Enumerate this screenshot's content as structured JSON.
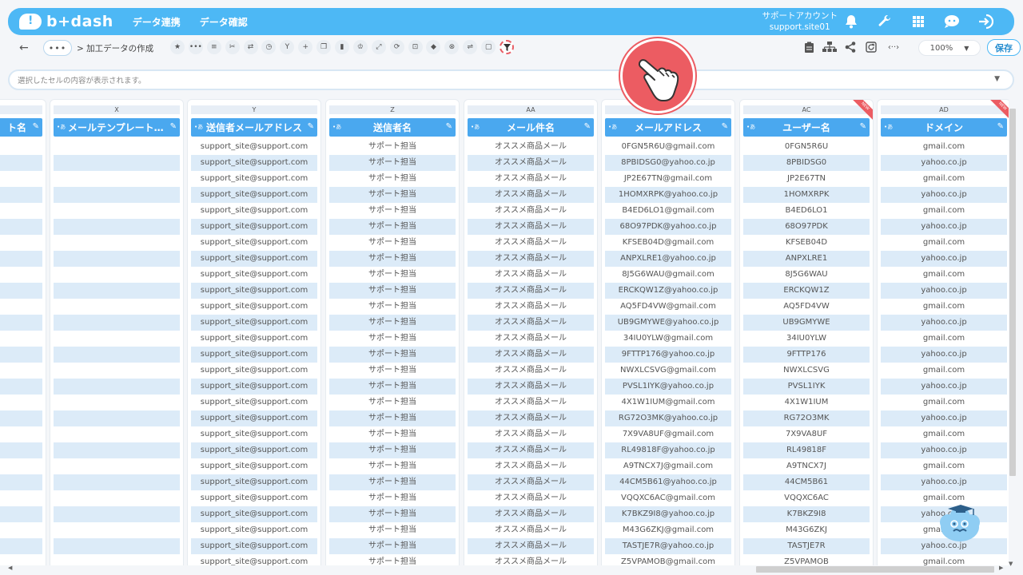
{
  "header": {
    "logo_text": "b+dash",
    "nav": [
      "データ連携",
      "データ確認"
    ],
    "account_label": "サポートアカウント",
    "account_id": "support.site01",
    "icons": [
      "bell-icon",
      "wrench-icon",
      "grid-icon",
      "chat-icon",
      "logout-icon"
    ]
  },
  "toolbar": {
    "more_label": "•••",
    "breadcrumb": "> 加工データの作成",
    "tool_icons": [
      "star-icon",
      "more-icon",
      "list-icon",
      "scissors-icon",
      "merge-icon",
      "timer-icon",
      "branch-icon",
      "plus-icon",
      "copy-icon",
      "trash-icon",
      "crown-icon",
      "expand-icon",
      "repeat-icon",
      "lock-icon",
      "box-icon",
      "close-circle-icon",
      "shuffle-icon",
      "square-icon",
      "filter-icon"
    ],
    "active_tool": "filter-icon",
    "right_icons": [
      "clipboard-icon",
      "hierarchy-icon",
      "share-icon",
      "refresh-icon",
      "code-icon"
    ],
    "zoom": "100%",
    "save_label": "保存"
  },
  "cellbar": {
    "placeholder": "選択したセルの内容が表示されます。"
  },
  "columns": [
    {
      "letter": "",
      "header": "ト名",
      "partial": true
    },
    {
      "letter": "X",
      "header": "メールテンプレート…",
      "empty": true
    },
    {
      "letter": "Y",
      "header": "送信者メールアドレス"
    },
    {
      "letter": "Z",
      "header": "送信者名"
    },
    {
      "letter": "AA",
      "header": "メール件名"
    },
    {
      "letter": "",
      "header": "メールアドレス"
    },
    {
      "letter": "AC",
      "header": "ユーザー名",
      "new": true
    },
    {
      "letter": "AD",
      "header": "ドメイン",
      "new": true
    }
  ],
  "new_badge": "NEW",
  "type_badge": "•あ",
  "rows": {
    "sender_email": "support_site@support.com",
    "sender_name": "サポート担当",
    "subject": "オススメ商品メール",
    "emails": [
      "0FGN5R6U@gmail.com",
      "8PBIDSG0@yahoo.co.jp",
      "JP2E67TN@gmail.com",
      "1HOMXRPK@yahoo.co.jp",
      "B4ED6LO1@gmail.com",
      "68O97PDK@yahoo.co.jp",
      "KFSEB04D@gmail.com",
      "ANPXLRE1@yahoo.co.jp",
      "8J5G6WAU@gmail.com",
      "ERCKQW1Z@yahoo.co.jp",
      "AQ5FD4VW@gmail.com",
      "UB9GMYWE@yahoo.co.jp",
      "34IU0YLW@gmail.com",
      "9FTTP176@yahoo.co.jp",
      "NWXLCSVG@gmail.com",
      "PVSL1IYK@yahoo.co.jp",
      "4X1W1IUM@gmail.com",
      "RG72O3MK@yahoo.co.jp",
      "7X9VA8UF@gmail.com",
      "RL49818F@yahoo.co.jp",
      "A9TNCX7J@gmail.com",
      "44CM5B61@yahoo.co.jp",
      "VQQXC6AC@gmail.com",
      "K7BKZ9I8@yahoo.co.jp",
      "M43G6ZKJ@gmail.com",
      "TASTJE7R@yahoo.co.jp",
      "Z5VPAMOB@gmail.com"
    ],
    "usernames": [
      "0FGN5R6U",
      "8PBIDSG0",
      "JP2E67TN",
      "1HOMXRPK",
      "B4ED6LO1",
      "68O97PDK",
      "KFSEB04D",
      "ANPXLRE1",
      "8J5G6WAU",
      "ERCKQW1Z",
      "AQ5FD4VW",
      "UB9GMYWE",
      "34IU0YLW",
      "9FTTP176",
      "NWXLCSVG",
      "PVSL1IYK",
      "4X1W1IUM",
      "RG72O3MK",
      "7X9VA8UF",
      "RL49818F",
      "A9TNCX7J",
      "44CM5B61",
      "VQQXC6AC",
      "K7BKZ9I8",
      "M43G6ZKJ",
      "TASTJE7R",
      "Z5VPAMOB"
    ],
    "domains": [
      "gmail.com",
      "yahoo.co.jp",
      "gmail.com",
      "yahoo.co.jp",
      "gmail.com",
      "yahoo.co.jp",
      "gmail.com",
      "yahoo.co.jp",
      "gmail.com",
      "yahoo.co.jp",
      "gmail.com",
      "yahoo.co.jp",
      "gmail.com",
      "yahoo.co.jp",
      "gmail.com",
      "yahoo.co.jp",
      "gmail.com",
      "yahoo.co.jp",
      "gmail.com",
      "yahoo.co.jp",
      "gmail.com",
      "yahoo.co.jp",
      "gmail.com",
      "yahoo.co.jp",
      "gmail.com",
      "yahoo.co.jp",
      "gmail.com"
    ]
  },
  "colors": {
    "brand": "#4db8f5",
    "header_cell": "#4aa8ef",
    "alt_row": "#dcebf8",
    "accent_red": "#ec5c62"
  }
}
